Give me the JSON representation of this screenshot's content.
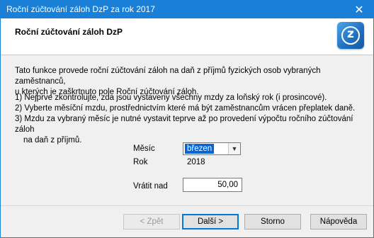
{
  "window": {
    "title": "Roční zúčtování záloh DzP za rok 2017"
  },
  "header": {
    "title": "Roční zúčtování záloh DzP",
    "logo_icon": "z-logo-icon"
  },
  "body": {
    "intro_line1": "Tato funkce provede roční zúčtování záloh na daň z příjmů fyzických osob vybraných zaměstnanců,",
    "intro_line2": "u kterých je zaškrtnuto pole Roční zúčtování záloh.",
    "step1": "1) Nejprve zkontrolujte, zda jsou vystaveny všechny mzdy za loňský rok (i prosincové).",
    "step2": "2) Vyberte měsíční mzdu, prostřednictvím které má být zaměstnancům vrácen přeplatek daně.",
    "step3_line1": "3) Mzdu za vybraný měsíc je nutné vystavit teprve až po provedení výpočtu ročního zúčtování záloh",
    "step3_line2": "na daň z příjmů."
  },
  "form": {
    "month_label": "Měsíc",
    "month_value": "březen",
    "year_label": "Rok",
    "year_value": "2018",
    "refund_label": "Vrátit nad",
    "refund_value": "50,00"
  },
  "buttons": {
    "back": "< Zpět",
    "next": "Další >",
    "cancel": "Storno",
    "help": "Nápověda"
  },
  "colors": {
    "titlebar": "#1a7fd6",
    "selection": "#0a64d2",
    "default_button_border": "#0078d7"
  }
}
